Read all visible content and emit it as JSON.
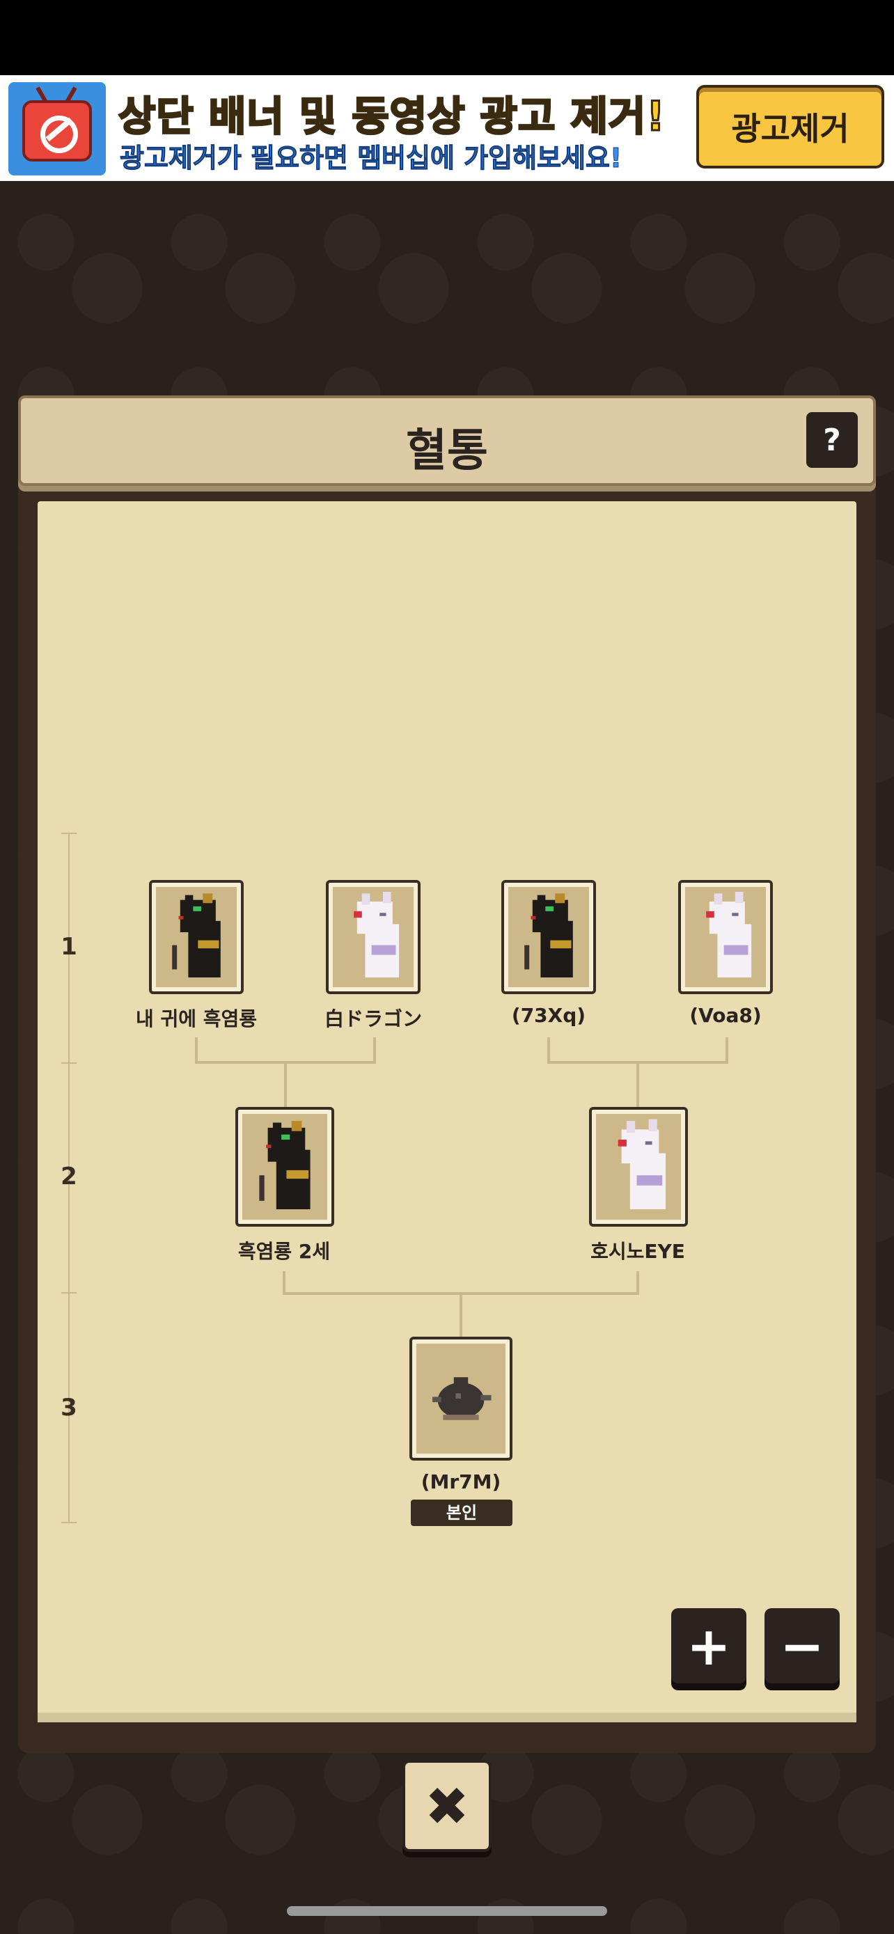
{
  "ad": {
    "title": "상단 배너 및 동영상 광고 제거!",
    "subtitle": "광고제거가 필요하면 멤버십에 가입해보세요!",
    "button_label": "광고제거"
  },
  "dialog": {
    "title": "혈통",
    "help_label": "?",
    "close_label": "✖"
  },
  "generations": [
    "1",
    "2",
    "3"
  ],
  "tree": {
    "gen1": [
      {
        "name": "내 귀에 흑염룡",
        "type": "black-dragon"
      },
      {
        "name": "白ドラゴン",
        "type": "white-dragon"
      },
      {
        "name": "(73Xq)",
        "type": "black-dragon"
      },
      {
        "name": "(Voa8)",
        "type": "white-dragon"
      }
    ],
    "gen2": [
      {
        "name": "흑염룡 2세",
        "type": "black-dragon"
      },
      {
        "name": "호시노EYE",
        "type": "white-dragon"
      }
    ],
    "gen3": [
      {
        "name": "(Mr7M)",
        "type": "egg",
        "badge": "본인"
      }
    ]
  },
  "zoom": {
    "plus": "+",
    "minus": "−"
  }
}
